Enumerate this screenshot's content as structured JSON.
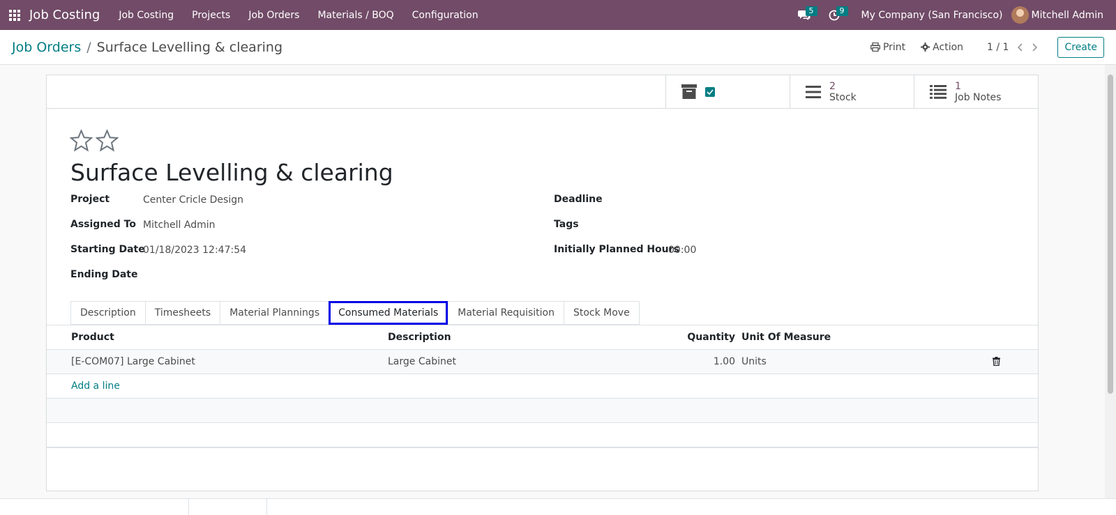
{
  "navbar": {
    "brand": "Job Costing",
    "menu": [
      "Job Costing",
      "Projects",
      "Job Orders",
      "Materials / BOQ",
      "Configuration"
    ],
    "messages_count": "5",
    "activities_count": "9",
    "company": "My Company (San Francisco)",
    "user": "Mitchell Admin",
    "color": "#714b67"
  },
  "control": {
    "breadcrumb_parent": "Job Orders",
    "breadcrumb_separator": "/",
    "breadcrumb_current": "Surface Levelling & clearing",
    "print_label": "Print",
    "action_label": "Action",
    "pager": "1 / 1",
    "create_label": "Create"
  },
  "buttonbox": {
    "archive_checked": true,
    "stock_count": "2",
    "stock_label": "Stock",
    "notes_count": "1",
    "notes_label": "Job Notes"
  },
  "form": {
    "title": "Surface Levelling & clearing",
    "project_label": "Project",
    "project_value": "Center Cricle Design",
    "assigned_label": "Assigned To",
    "assigned_value": "Mitchell Admin",
    "start_label": "Starting Date",
    "start_value": "01/18/2023 12:47:54",
    "end_label": "Ending Date",
    "deadline_label": "Deadline",
    "tags_label": "Tags",
    "hours_label": "Initially Planned Hours",
    "hours_value": "00:00"
  },
  "tabs": [
    "Description",
    "Timesheets",
    "Material Plannings",
    "Consumed Materials",
    "Material Requisition",
    "Stock Move"
  ],
  "active_tab": "Consumed Materials",
  "grid": {
    "headers": {
      "product": "Product",
      "description": "Description",
      "quantity": "Quantity",
      "uom": "Unit Of Measure"
    },
    "rows": [
      {
        "product": "[E-COM07] Large Cabinet",
        "description": "Large Cabinet",
        "quantity": "1.00",
        "uom": "Units"
      }
    ],
    "add_line": "Add a line"
  },
  "colors": {
    "accent": "#017e84",
    "highlight": "#0000e6"
  }
}
